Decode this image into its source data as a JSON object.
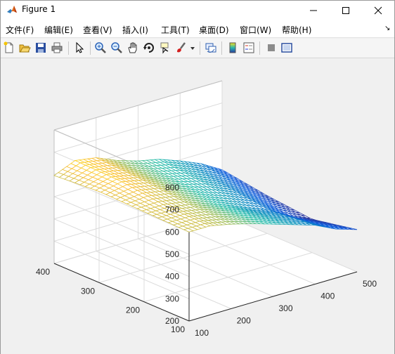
{
  "window": {
    "title": "Figure 1"
  },
  "menu": [
    {
      "label": "文件(F)",
      "name": "menu-file"
    },
    {
      "label": "编辑(E)",
      "name": "menu-edit"
    },
    {
      "label": "查看(V)",
      "name": "menu-view"
    },
    {
      "label": "插入(I)",
      "name": "menu-insert"
    },
    {
      "label": "工具(T)",
      "name": "menu-tools"
    },
    {
      "label": "桌面(D)",
      "name": "menu-desktop"
    },
    {
      "label": "窗口(W)",
      "name": "menu-window"
    },
    {
      "label": "帮助(H)",
      "name": "menu-help"
    }
  ],
  "toolbar": [
    "new-figure-icon",
    "open-file-icon",
    "save-icon",
    "print-icon",
    "pointer-icon",
    "zoom-in-icon",
    "zoom-out-icon",
    "pan-hand-icon",
    "rotate-3d-icon",
    "data-cursor-icon",
    "brush-icon",
    "brush-dropdown-icon",
    "link-plot-icon",
    "colorbar-icon",
    "legend-icon",
    "hide-plot-tools-icon",
    "show-plot-tools-icon"
  ],
  "chart_data": {
    "type": "surface-mesh",
    "x_ticks": [
      100,
      200,
      300,
      400,
      500
    ],
    "y_ticks": [
      100,
      200,
      300,
      400
    ],
    "z_ticks": [
      200,
      300,
      400,
      500,
      600,
      700,
      800
    ],
    "xlim": [
      100,
      500
    ],
    "ylim": [
      100,
      400
    ],
    "zlim": [
      200,
      800
    ],
    "grid": true,
    "colormap": "parula",
    "surface_z_range": [
      340,
      660
    ],
    "rows_y": [
      100,
      200,
      300,
      400
    ],
    "cols_x": [
      100,
      150,
      200,
      250,
      300,
      350,
      400,
      450,
      500
    ],
    "z": [
      [
        600,
        600,
        580,
        555,
        525,
        495,
        465,
        420,
        390
      ],
      [
        605,
        605,
        590,
        555,
        520,
        480,
        445,
        390,
        350
      ],
      [
        610,
        630,
        610,
        570,
        535,
        510,
        470,
        420,
        370
      ],
      [
        595,
        635,
        620,
        580,
        550,
        530,
        495,
        455,
        400
      ]
    ]
  }
}
